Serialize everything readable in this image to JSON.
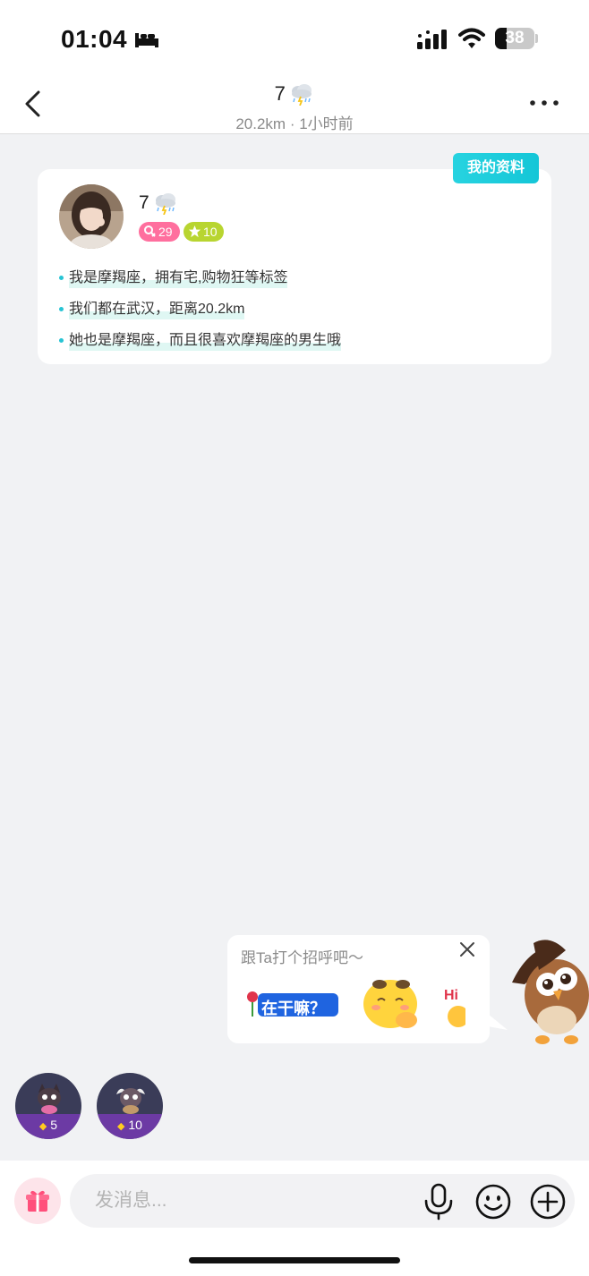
{
  "status_bar": {
    "time": "01:04",
    "battery": "38"
  },
  "nav": {
    "title": "7",
    "subtitle": "20.2km · 1小时前"
  },
  "profile": {
    "tag": "我的资料",
    "name": "7",
    "age": "29",
    "level": "10",
    "lines": [
      "我是摩羯座，拥有宅,购物狂等标签",
      "我们都在武汉，距离20.2km",
      "她也是摩羯座，而且很喜欢摩羯座的男生哦"
    ]
  },
  "greet": {
    "text": "跟Ta打个招呼吧～",
    "sticker_1": "在干嘛？",
    "sticker_3": "Hi"
  },
  "gifts": [
    {
      "count": "5"
    },
    {
      "count": "10"
    }
  ],
  "input": {
    "placeholder": "发消息..."
  },
  "colors": {
    "accent_cyan": "#14c6d7",
    "age_badge": "#ff6f9e",
    "level_badge": "#b8d530",
    "gift_purple": "#6c3aa4"
  }
}
